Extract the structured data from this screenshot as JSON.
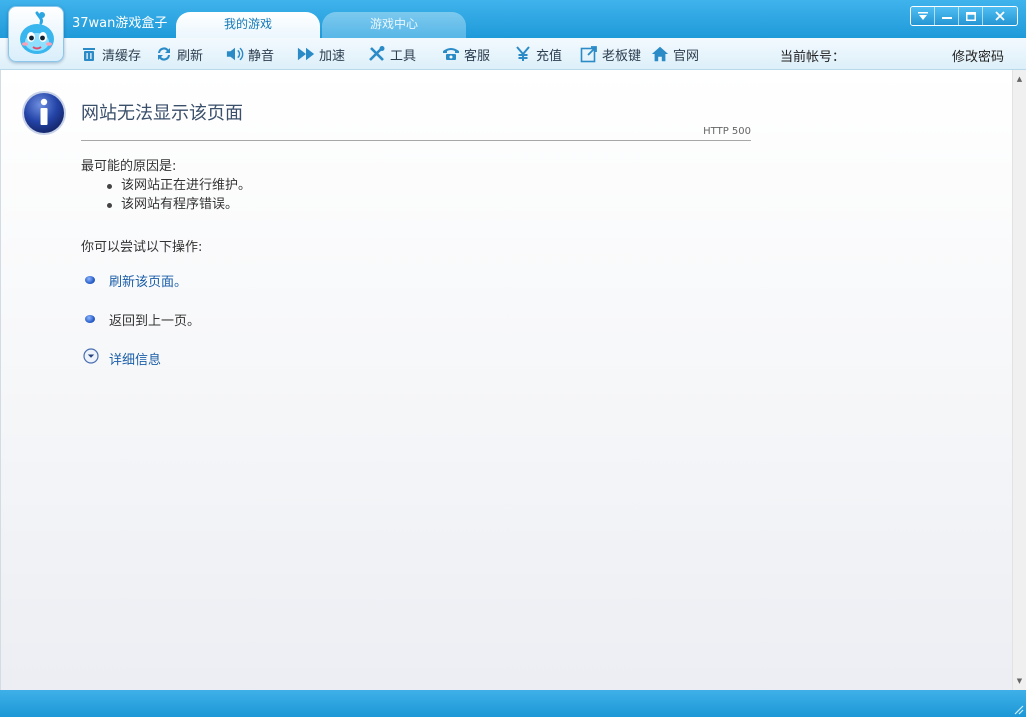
{
  "window": {
    "title": "37wan游戏盒子",
    "tabs": [
      {
        "label": "我的游戏",
        "active": true
      },
      {
        "label": "游戏中心",
        "active": false
      }
    ],
    "controls": [
      "menu-icon",
      "minimize-icon",
      "maximize-icon",
      "close-icon"
    ]
  },
  "toolbar": {
    "items": [
      {
        "label": "清缓存",
        "icon": "trash-icon"
      },
      {
        "label": "刷新",
        "icon": "refresh-icon"
      },
      {
        "label": "静音",
        "icon": "speaker-icon"
      },
      {
        "label": "加速",
        "icon": "fast-forward-icon"
      },
      {
        "label": "工具",
        "icon": "tools-icon"
      },
      {
        "label": "客服",
        "icon": "phone-icon"
      },
      {
        "label": "充值",
        "icon": "yen-icon"
      },
      {
        "label": "老板键",
        "icon": "boss-key-icon"
      },
      {
        "label": "官网",
        "icon": "home-icon"
      }
    ],
    "account_label": "当前帐号：",
    "change_password": "修改密码"
  },
  "error_page": {
    "title": "网站无法显示该页面",
    "code": "HTTP 500",
    "causes_heading": "最可能的原因是:",
    "causes": [
      "该网站正在进行维护。",
      "该网站有程序错误。"
    ],
    "try_heading": "你可以尝试以下操作:",
    "actions": [
      "刷新该页面。",
      "返回到上一页。"
    ],
    "details": "详细信息"
  },
  "colors": {
    "titlebar": "#2aa6e2",
    "link": "#1b5ea8",
    "text": "#333333"
  }
}
